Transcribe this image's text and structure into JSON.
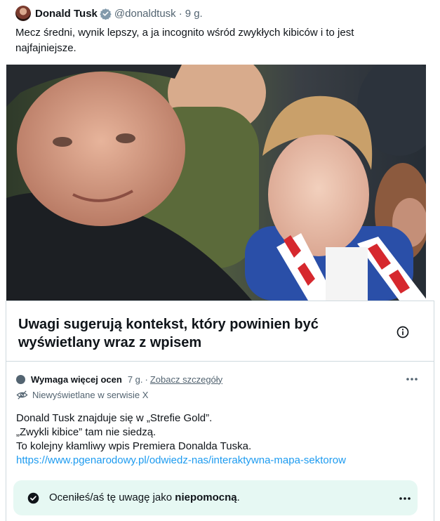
{
  "tweet": {
    "author_name": "Donald Tusk",
    "author_handle": "@donaldtusk",
    "separator": "·",
    "time": "9 g.",
    "text": "Mecz średni, wynik lepszy, a ja incognito wśród zwykłych kibiców i to jest najfajniejsze."
  },
  "community_note": {
    "title": "Uwagi sugerują kontekst, który powinien być wyświetlany wraz z wpisem",
    "status_label": "Wymaga więcej ocen",
    "time": "7 g.",
    "separator": "·",
    "details_link": "Zobacz szczegóły",
    "visibility": "Niewyświetlane w serwisie X",
    "body_lines": [
      "Donald Tusk znajduje się w „Strefie Gold”.",
      "„Zwykli kibice” tam nie siedzą.",
      "To kolejny kłamliwy wpis Premiera Donalda Tuska."
    ],
    "link": "https://www.pgenarodowy.pl/odwiedz-nas/interaktywna-mapa-sektorow",
    "rating": {
      "prefix": "Oceniłeś/aś tę uwagę jako",
      "value": "niepomocną",
      "suffix": "."
    }
  },
  "icons": {
    "verified": "verified-badge-icon",
    "info": "info-icon",
    "more": "more-horizontal-icon",
    "not_shown": "eye-off-icon",
    "check": "check-circle-icon"
  },
  "colors": {
    "accent_link": "#1d9bf0",
    "verified_badge": "#829aab",
    "rated_background": "#e6f8f3",
    "secondary_text": "#536471"
  }
}
